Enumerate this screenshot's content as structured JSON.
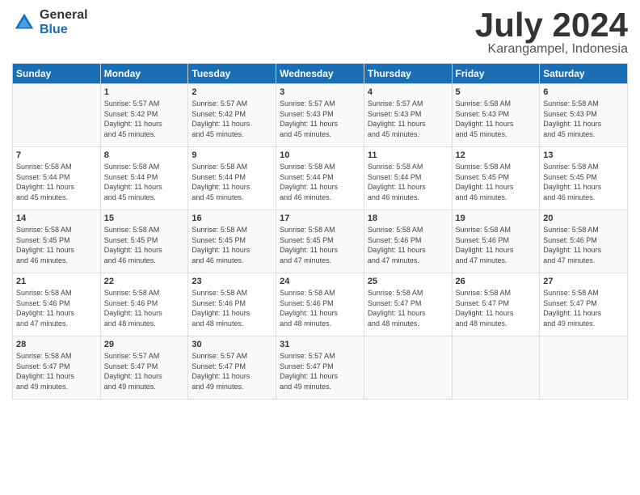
{
  "header": {
    "logo_general": "General",
    "logo_blue": "Blue",
    "title": "July 2024",
    "subtitle": "Karangampel, Indonesia"
  },
  "days_of_week": [
    "Sunday",
    "Monday",
    "Tuesday",
    "Wednesday",
    "Thursday",
    "Friday",
    "Saturday"
  ],
  "weeks": [
    [
      {
        "num": "",
        "info": ""
      },
      {
        "num": "1",
        "info": "Sunrise: 5:57 AM\nSunset: 5:42 PM\nDaylight: 11 hours\nand 45 minutes."
      },
      {
        "num": "2",
        "info": "Sunrise: 5:57 AM\nSunset: 5:42 PM\nDaylight: 11 hours\nand 45 minutes."
      },
      {
        "num": "3",
        "info": "Sunrise: 5:57 AM\nSunset: 5:43 PM\nDaylight: 11 hours\nand 45 minutes."
      },
      {
        "num": "4",
        "info": "Sunrise: 5:57 AM\nSunset: 5:43 PM\nDaylight: 11 hours\nand 45 minutes."
      },
      {
        "num": "5",
        "info": "Sunrise: 5:58 AM\nSunset: 5:43 PM\nDaylight: 11 hours\nand 45 minutes."
      },
      {
        "num": "6",
        "info": "Sunrise: 5:58 AM\nSunset: 5:43 PM\nDaylight: 11 hours\nand 45 minutes."
      }
    ],
    [
      {
        "num": "7",
        "info": "Sunrise: 5:58 AM\nSunset: 5:44 PM\nDaylight: 11 hours\nand 45 minutes."
      },
      {
        "num": "8",
        "info": "Sunrise: 5:58 AM\nSunset: 5:44 PM\nDaylight: 11 hours\nand 45 minutes."
      },
      {
        "num": "9",
        "info": "Sunrise: 5:58 AM\nSunset: 5:44 PM\nDaylight: 11 hours\nand 45 minutes."
      },
      {
        "num": "10",
        "info": "Sunrise: 5:58 AM\nSunset: 5:44 PM\nDaylight: 11 hours\nand 46 minutes."
      },
      {
        "num": "11",
        "info": "Sunrise: 5:58 AM\nSunset: 5:44 PM\nDaylight: 11 hours\nand 46 minutes."
      },
      {
        "num": "12",
        "info": "Sunrise: 5:58 AM\nSunset: 5:45 PM\nDaylight: 11 hours\nand 46 minutes."
      },
      {
        "num": "13",
        "info": "Sunrise: 5:58 AM\nSunset: 5:45 PM\nDaylight: 11 hours\nand 46 minutes."
      }
    ],
    [
      {
        "num": "14",
        "info": "Sunrise: 5:58 AM\nSunset: 5:45 PM\nDaylight: 11 hours\nand 46 minutes."
      },
      {
        "num": "15",
        "info": "Sunrise: 5:58 AM\nSunset: 5:45 PM\nDaylight: 11 hours\nand 46 minutes."
      },
      {
        "num": "16",
        "info": "Sunrise: 5:58 AM\nSunset: 5:45 PM\nDaylight: 11 hours\nand 46 minutes."
      },
      {
        "num": "17",
        "info": "Sunrise: 5:58 AM\nSunset: 5:45 PM\nDaylight: 11 hours\nand 47 minutes."
      },
      {
        "num": "18",
        "info": "Sunrise: 5:58 AM\nSunset: 5:46 PM\nDaylight: 11 hours\nand 47 minutes."
      },
      {
        "num": "19",
        "info": "Sunrise: 5:58 AM\nSunset: 5:46 PM\nDaylight: 11 hours\nand 47 minutes."
      },
      {
        "num": "20",
        "info": "Sunrise: 5:58 AM\nSunset: 5:46 PM\nDaylight: 11 hours\nand 47 minutes."
      }
    ],
    [
      {
        "num": "21",
        "info": "Sunrise: 5:58 AM\nSunset: 5:46 PM\nDaylight: 11 hours\nand 47 minutes."
      },
      {
        "num": "22",
        "info": "Sunrise: 5:58 AM\nSunset: 5:46 PM\nDaylight: 11 hours\nand 48 minutes."
      },
      {
        "num": "23",
        "info": "Sunrise: 5:58 AM\nSunset: 5:46 PM\nDaylight: 11 hours\nand 48 minutes."
      },
      {
        "num": "24",
        "info": "Sunrise: 5:58 AM\nSunset: 5:46 PM\nDaylight: 11 hours\nand 48 minutes."
      },
      {
        "num": "25",
        "info": "Sunrise: 5:58 AM\nSunset: 5:47 PM\nDaylight: 11 hours\nand 48 minutes."
      },
      {
        "num": "26",
        "info": "Sunrise: 5:58 AM\nSunset: 5:47 PM\nDaylight: 11 hours\nand 48 minutes."
      },
      {
        "num": "27",
        "info": "Sunrise: 5:58 AM\nSunset: 5:47 PM\nDaylight: 11 hours\nand 49 minutes."
      }
    ],
    [
      {
        "num": "28",
        "info": "Sunrise: 5:58 AM\nSunset: 5:47 PM\nDaylight: 11 hours\nand 49 minutes."
      },
      {
        "num": "29",
        "info": "Sunrise: 5:57 AM\nSunset: 5:47 PM\nDaylight: 11 hours\nand 49 minutes."
      },
      {
        "num": "30",
        "info": "Sunrise: 5:57 AM\nSunset: 5:47 PM\nDaylight: 11 hours\nand 49 minutes."
      },
      {
        "num": "31",
        "info": "Sunrise: 5:57 AM\nSunset: 5:47 PM\nDaylight: 11 hours\nand 49 minutes."
      },
      {
        "num": "",
        "info": ""
      },
      {
        "num": "",
        "info": ""
      },
      {
        "num": "",
        "info": ""
      }
    ]
  ]
}
